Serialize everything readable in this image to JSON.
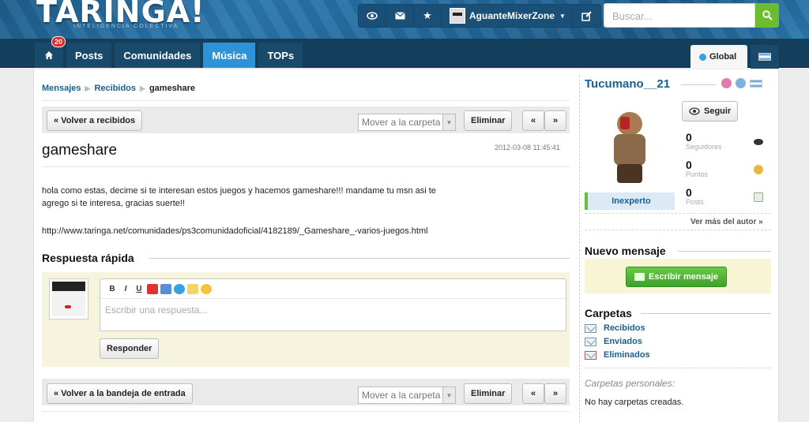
{
  "header": {
    "logo": "TARINGA!",
    "logo_sub": "INTELIGENCIA COLECTIVA",
    "username": "AguanteMixerZone",
    "search_placeholder": "Buscar..."
  },
  "nav": {
    "badge": "20",
    "items": [
      "Posts",
      "Comunidades",
      "Música",
      "TOPs"
    ],
    "global": "Global"
  },
  "breadcrumb": {
    "mensajes": "Mensajes",
    "recibidos": "Recibidos",
    "current": "gameshare"
  },
  "toolbar_top": {
    "back": "« Volver a recibidos",
    "move": "Mover a la carpeta",
    "delete": "Eliminar",
    "prev": "«",
    "next": "»"
  },
  "message": {
    "title": "gameshare",
    "date": "2012-03-08 11:45:41",
    "body_line1": "hola como estas, decime si te interesan estos juegos y hacemos gameshare!!! mandame tu msn asi te",
    "body_line2": "agrego si te interesa, gracias suerte!!",
    "link": "http://www.taringa.net/comunidades/ps3comunidadoficial/4182189/_Gameshare_-varios-juegos.html"
  },
  "reply": {
    "title": "Respuesta rápida",
    "placeholder": "Escribir una respuesta...",
    "submit": "Responder",
    "tools": [
      "B",
      "I",
      "U"
    ]
  },
  "toolbar_bottom": {
    "back": "« Volver a la bandeja de entrada",
    "move": "Mover a la carpeta",
    "delete": "Eliminar",
    "prev": "«",
    "next": "»"
  },
  "sidebar": {
    "author": "Tucumano__21",
    "follow": "Seguir",
    "rank": "Inexperto",
    "stats": [
      {
        "num": "0",
        "label": "Seguidores"
      },
      {
        "num": "0",
        "label": "Puntos"
      },
      {
        "num": "0",
        "label": "Posts"
      }
    ],
    "more_author": "Ver más del autor »",
    "new_message_title": "Nuevo mensaje",
    "write_button": "Escribir mensaje",
    "folders_title": "Carpetas",
    "folders": [
      "Recibidos",
      "Enviados",
      "Eliminados"
    ],
    "personal_folders": "Carpetas personales:",
    "no_folders": "No hay carpetas creadas."
  },
  "colors": {
    "brand_blue": "#1f5e8c",
    "nav_active": "#2d93d6",
    "link": "#1a5f92",
    "green": "#6bbd2e"
  }
}
